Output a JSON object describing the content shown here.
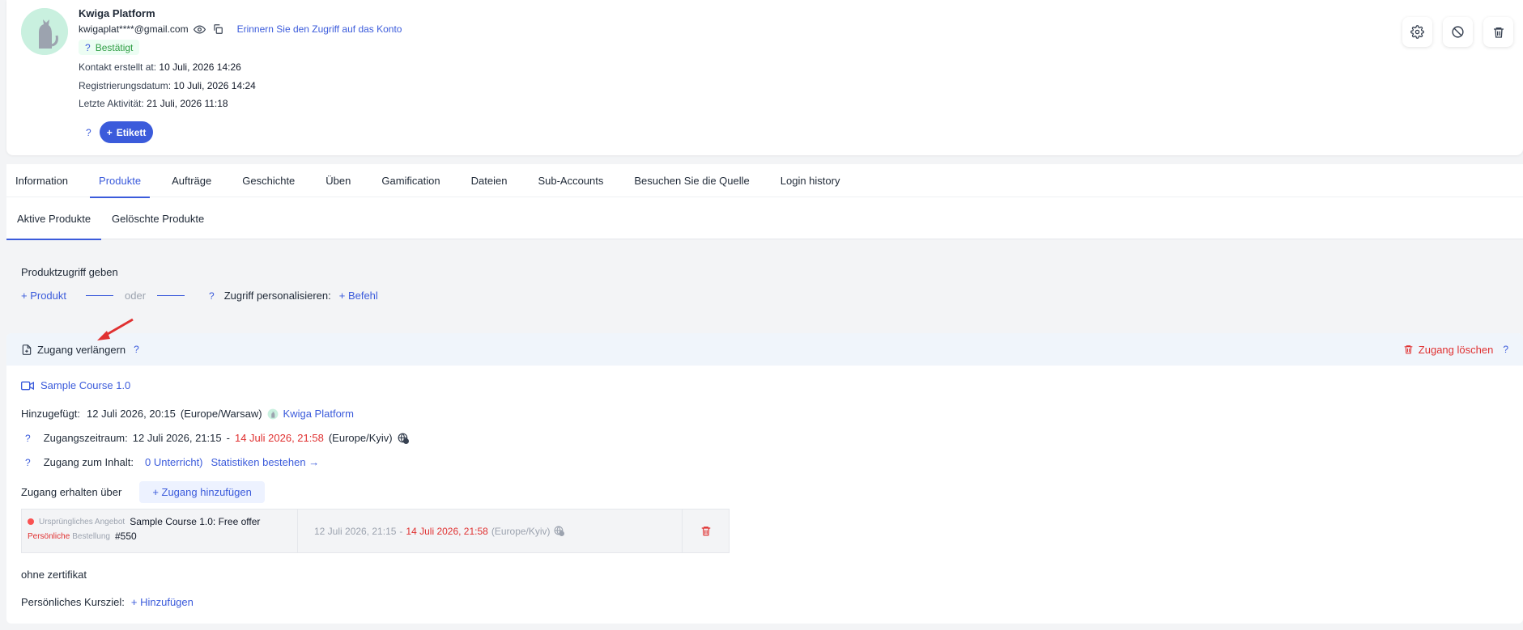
{
  "profile": {
    "name": "Kwiga Platform",
    "email": "kwigaplat****@gmail.com",
    "remind_link": "Erinnern Sie den Zugriff auf das Konto",
    "badge_q": "?",
    "badge_label": "Bestätigt",
    "contact_created_label": "Kontakt erstellt at:",
    "contact_created_value": "10 Juli, 2026 14:26",
    "registration_label": "Registrierungsdatum:",
    "registration_value": "10 Juli, 2026 14:24",
    "last_activity_label": "Letzte Aktivität:",
    "last_activity_value": "21 Juli, 2026 11:18",
    "etikett_q": "?",
    "etikett_label": "Etikett"
  },
  "main_tabs": [
    {
      "label": "Information"
    },
    {
      "label": "Produkte"
    },
    {
      "label": "Aufträge"
    },
    {
      "label": "Geschichte"
    },
    {
      "label": "Üben"
    },
    {
      "label": "Gamification"
    },
    {
      "label": "Dateien"
    },
    {
      "label": "Sub-Accounts"
    },
    {
      "label": "Besuchen Sie die Quelle"
    },
    {
      "label": "Login history"
    }
  ],
  "sub_tabs": [
    {
      "label": "Aktive Produkte"
    },
    {
      "label": "Gelöschte Produkte"
    }
  ],
  "grant": {
    "title": "Produktzugriff geben",
    "add_product": "+ Produkt",
    "oder": "oder",
    "q": "?",
    "personalize_label": "Zugriff personalisieren:",
    "add_command": "+ Befehl"
  },
  "product": {
    "extend_label": "Zugang verlängern",
    "extend_q": "?",
    "delete_label": "Zugang löschen",
    "delete_q": "?",
    "course_name": "Sample Course 1.0",
    "added_label": "Hinzugefügt:",
    "added_value": "12 Juli 2026, 20:15",
    "added_tz": "(Europe/Warsaw)",
    "added_by": "Kwiga Platform",
    "period_q": "?",
    "period_label": "Zugangszeitraum:",
    "period_start": "12 Juli 2026, 21:15",
    "period_dash": "-",
    "period_end": "14 Juli 2026, 21:58",
    "period_tz": "(Europe/Kyiv)",
    "content_q": "?",
    "content_label": "Zugang zum Inhalt:",
    "content_value": "0 Unterricht)",
    "stats_link": "Statistiken bestehen →",
    "via_label": "Zugang erhalten über",
    "add_access": "+ Zugang hinzufügen",
    "offer_tag": "Ursprüngliches Angebot",
    "offer_name": "Sample Course 1.0: Free offer",
    "order_tag_red": "Persönliche",
    "order_tag_muted": "Bestellung",
    "order_number": "#550",
    "offer_start": "12 Juli 2026, 21:15",
    "offer_dash": "-",
    "offer_end": "14 Juli 2026, 21:58",
    "offer_tz": "(Europe/Kyiv)",
    "certificate": "ohne zertifikat",
    "goal_label": "Persönliches Kursziel:",
    "goal_add": "+ Hinzufügen"
  },
  "colors": {
    "accent": "#3b5bdb",
    "danger": "#e03131",
    "success": "#2f9e44"
  }
}
